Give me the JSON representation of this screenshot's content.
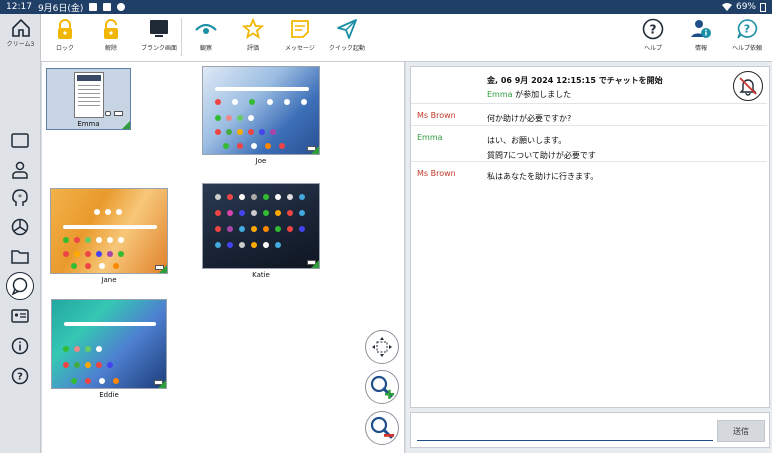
{
  "status_bar": {
    "time": "12:17",
    "date": "9月6日(金)",
    "battery": "69%"
  },
  "sidebar": {
    "class_label": "クリーム3"
  },
  "toolbar": {
    "lock": "ロック",
    "unlock": "解除",
    "blank_screen": "ブランク画面",
    "observe": "観察",
    "rate": "評価",
    "message": "メッセージ",
    "quick_launch": "クイック起動",
    "help": "ヘルプ",
    "info": "情報",
    "help_request": "ヘルプ依頼"
  },
  "devices": [
    {
      "name": "Emma"
    },
    {
      "name": "Joe"
    },
    {
      "name": "Jane"
    },
    {
      "name": "Katie"
    },
    {
      "name": "Eddie"
    }
  ],
  "chat": {
    "header": "金, 06 9月 2024 12:15:15 でチャットを開始",
    "joined_name": "Emma",
    "joined_text": " が参加しました",
    "messages": [
      {
        "sender": "Ms Brown",
        "lines": [
          "何か助けが必要ですか?"
        ]
      },
      {
        "sender": "Emma",
        "lines": [
          "はい、お願いします。",
          "質問7について助けが必要です"
        ]
      },
      {
        "sender": "Ms Brown",
        "lines": [
          "私はあなたを助けに行きます。"
        ]
      }
    ],
    "input_value": "",
    "send_label": "送信"
  },
  "colors": {
    "accent_yellow": "#f2b705",
    "accent_teal": "#1a8fa6",
    "nav_dark": "#1f3f66",
    "sender_teacher": "#c0392b",
    "sender_student": "#2f9e3f"
  }
}
